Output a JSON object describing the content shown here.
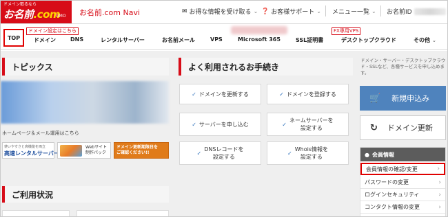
{
  "header": {
    "logo": {
      "tagline": "ドメイン取るなら",
      "brand_main": "お名前",
      "brand_com": ".com",
      "company": "GMO"
    },
    "navi_title": "お名前.com Navi",
    "links": [
      {
        "label": "お得な情報を受け取る",
        "icon": "mail-icon"
      },
      {
        "label": "お客様サポート",
        "icon": "help-icon"
      },
      {
        "label": "メニュー一覧",
        "icon": ""
      },
      {
        "label": "お名前ID",
        "icon": ""
      }
    ]
  },
  "nav": {
    "items": [
      "TOP",
      "ドメイン",
      "DNS",
      "レンタルサーバー",
      "お名前メール",
      "VPS",
      "Microsoft 365",
      "SSL証明書",
      "デスクトップクラウド",
      "その他"
    ],
    "badge_domain": "ドメイン設定はこちら",
    "badge_fx": "FX専用VPS"
  },
  "topics": {
    "title": "トピックス",
    "caption": "ホームページ＆メール運用はこちら",
    "mini1_line1": "使いやすさと高機能を両立",
    "mini1_line2": "高速レンタルサーバー",
    "mini2_text": "Webサイト\n制作パック",
    "mini3_text": "ドメイン更新期限日を\nご確認ください!!"
  },
  "usage": {
    "title": "ご利用状況"
  },
  "procedures": {
    "title": "よく利用されるお手続き",
    "buttons": [
      "ドメインを更新する",
      "ドメインを登録する",
      "サーバーを申し込む",
      "ネームサーバーを\n設定する",
      "DNSレコードを\n設定する",
      "Whois情報を\n設定する"
    ]
  },
  "side": {
    "note": "ドメイン・サーバー・デスクトップクラウド・SSLなど、各種サービスを申し込めます。",
    "new_app_label": "新規申込み",
    "renew_label": "ドメイン更新",
    "member_title": "会員情報",
    "member_items": [
      "会員情報の確認/変更",
      "パスワードの変更",
      "ログインセキュリティ",
      "コンタクト情報の変更"
    ]
  },
  "colors": {
    "brand_red": "#d70c18",
    "accent_blue": "#4f83bd",
    "highlight_red": "#e00000"
  }
}
